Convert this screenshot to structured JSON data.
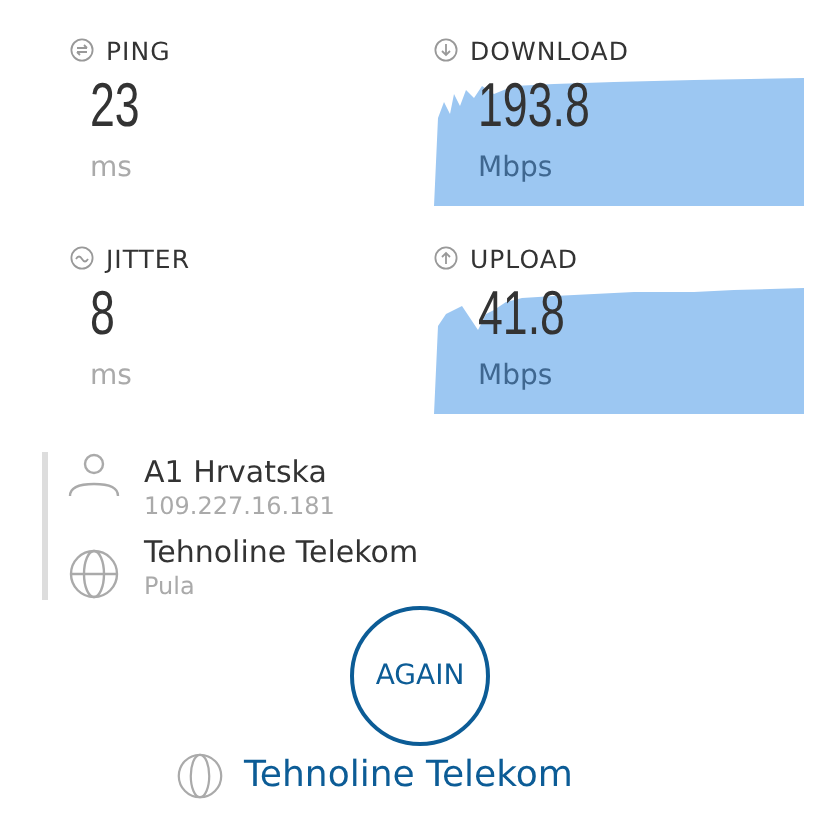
{
  "metrics": [
    {
      "kind": "ping",
      "label": "PING",
      "value": "23",
      "unit": "ms"
    },
    {
      "kind": "download",
      "label": "DOWNLOAD",
      "value": "193.8",
      "unit": "Mbps"
    },
    {
      "kind": "jitter",
      "label": "JITTER",
      "value": "8",
      "unit": "ms"
    },
    {
      "kind": "upload",
      "label": "UPLOAD",
      "value": "41.8",
      "unit": "Mbps"
    }
  ],
  "provider": {
    "name": "A1 Hrvatska",
    "ip": "109.227.16.181"
  },
  "server": {
    "name": "Tehnoline Telekom",
    "location": "Pula"
  },
  "again_button": "AGAIN",
  "bottom_server": "Tehnoline Telekom"
}
